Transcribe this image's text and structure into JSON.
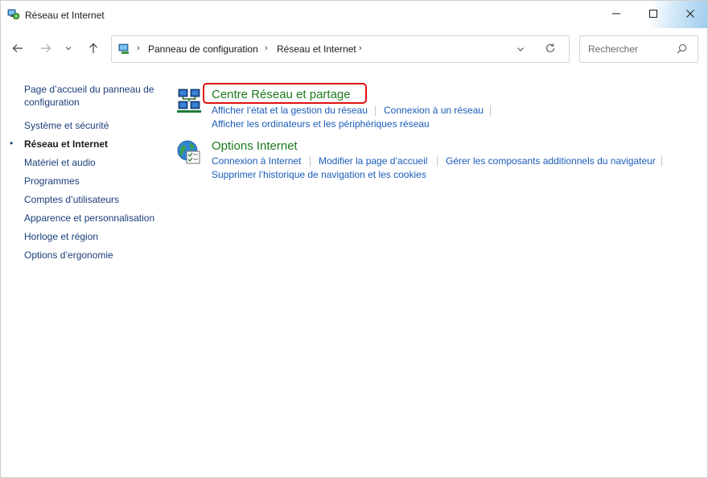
{
  "window": {
    "title": "Réseau et Internet",
    "accent_color": "#9fcdee"
  },
  "titlebar": {
    "minimize_icon": "minimize-icon",
    "maximize_icon": "maximize-icon",
    "close_icon": "close-icon"
  },
  "navigation": {
    "back_icon": "arrow-left-icon",
    "forward_icon": "arrow-right-icon",
    "recent_icon": "chevron-down-icon",
    "up_icon": "arrow-up-icon"
  },
  "address": {
    "breadcrumbs": [
      "Panneau de configuration",
      "Réseau et Internet"
    ],
    "dropdown_icon": "chevron-down-icon",
    "refresh_icon": "refresh-icon"
  },
  "search": {
    "placeholder": "Rechercher",
    "value": ""
  },
  "sidebar": {
    "items": [
      {
        "label": "Page d’accueil du panneau de configuration",
        "current": false
      },
      {
        "label": "Système et sécurité",
        "current": false
      },
      {
        "label": "Réseau et Internet",
        "current": true
      },
      {
        "label": "Matériel et audio",
        "current": false
      },
      {
        "label": "Programmes",
        "current": false
      },
      {
        "label": "Comptes d’utilisateurs",
        "current": false
      },
      {
        "label": "Apparence et personnalisation",
        "current": false
      },
      {
        "label": "Horloge et région",
        "current": false
      },
      {
        "label": "Options d’ergonomie",
        "current": false
      }
    ],
    "home_line1": "Page d’accueil du panneau de",
    "home_line2": "configuration"
  },
  "categories": [
    {
      "title": "Centre Réseau et partage",
      "icon": "network-computers-icon",
      "highlighted": true,
      "highlight_color": "#e01010",
      "tasks": [
        "Afficher l’état et la gestion du réseau",
        "Connexion à un réseau",
        "Afficher les ordinateurs et les périphériques réseau"
      ]
    },
    {
      "title": "Options Internet",
      "icon": "globe-settings-icon",
      "highlighted": false,
      "tasks": [
        "Connexion à Internet",
        "Modifier la page d’accueil",
        "Gérer les composants additionnels du navigateur",
        "Supprimer l’historique de navigation et les cookies"
      ]
    }
  ],
  "colors": {
    "category_title": "#1e7b1e",
    "task_link": "#1a5cb8",
    "sidebar_link": "#1a3e7a"
  }
}
